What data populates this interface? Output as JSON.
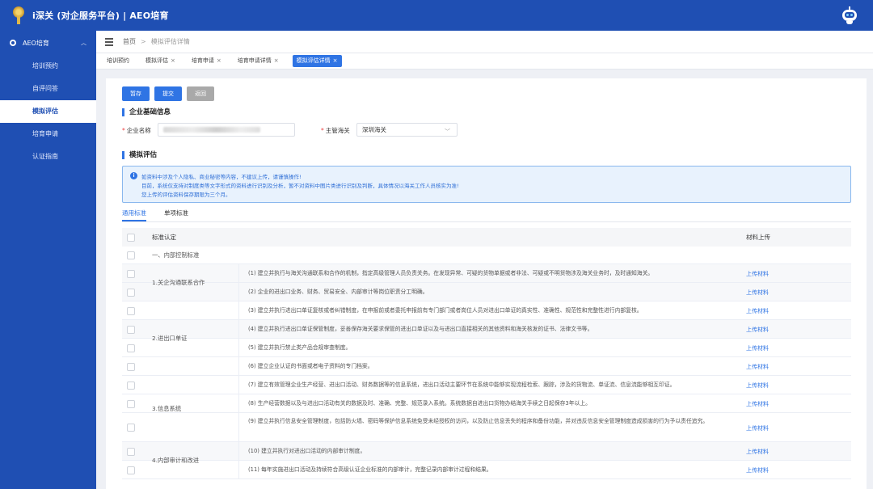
{
  "header": {
    "title": "i深关 (对企服务平台) | AEO培育"
  },
  "sidebar": {
    "group_label": "AEO培育",
    "items": [
      {
        "label": "培训预约",
        "active": false
      },
      {
        "label": "自评问答",
        "active": false
      },
      {
        "label": "模拟评估",
        "active": true
      },
      {
        "label": "培育申请",
        "active": false
      },
      {
        "label": "认证指南",
        "active": false
      }
    ]
  },
  "breadcrumb": {
    "home": "首页",
    "current": "模拟评估详情"
  },
  "tabs": [
    {
      "label": "培训预约",
      "closable": false,
      "active": false
    },
    {
      "label": "模拟评估",
      "closable": true,
      "active": false
    },
    {
      "label": "培育申请",
      "closable": true,
      "active": false
    },
    {
      "label": "培育申请详情",
      "closable": true,
      "active": false
    },
    {
      "label": "模拟评估详情",
      "closable": true,
      "active": true
    }
  ],
  "toolbar": {
    "save_label": "暂存",
    "submit_label": "提交",
    "back_label": "返回"
  },
  "basic_info": {
    "section_title": "企业基础信息",
    "company_label": "企业名称",
    "customs_label": "主管海关",
    "customs_value": "深圳海关"
  },
  "evaluation": {
    "section_title": "模拟评估",
    "notice_lines": [
      "如资料中涉及个人隐私、商业秘密等内容，不建议上传，请谨慎操作!",
      "目前，系统仅支持对制度类等文字形式的资料进行识别及分析，暂不对资料中图片类进行识别及判断，具体情况以海关工作人员核实为准!",
      "您上传的评估资料保存期限为三个月。"
    ],
    "subtabs": [
      "通用标准",
      "单项标准"
    ]
  },
  "table": {
    "col_standard": "标准认定",
    "col_upload": "材料上传",
    "section_row": "一、内部控制标准",
    "upload_label": "上传材料",
    "groups": [
      {
        "name": "1.关企沟通联系合作",
        "items": [
          "(1) 建立并执行与海关沟通联系和合作的机制，指定高级管理人员负责关务。在发现异常、可疑的货物单据或者非法、可疑或不明货物涉及海关业务时，及时通知海关。",
          "(2) 企业的进出口业务、财务、贸易安全、内部审计等岗位职责分工明确。"
        ]
      },
      {
        "name": "2.进出口单证",
        "items": [
          "(3) 建立并执行进出口单证复核或者纠错制度，在申报前或者委托申报前有专门部门或者岗位人员对进出口单证的真实性、准确性、规范性和完整性进行内部复核。",
          "(4) 建立并执行进出口单证保管制度，妥善保存海关要求保管的进出口单证以及与进出口直接相关的其他资料和海关核发的证书、法律文书等。",
          "(5) 建立并执行禁止类产品合规审查制度。",
          "(6) 建立企业认证的书面或者电子资料的专门档案。"
        ]
      },
      {
        "name": "3.信息系统",
        "items": [
          "(7) 建立有效管理企业生产经营、进出口活动、财务数据等的信息系统，进出口活动主要环节在系统中能够实现流程检索、跟踪，涉及的货物流、单证流、信息流能够相互印证。",
          "(8) 生产经营数据以及与进出口活动有关的数据及时、准确、完整、规范录入系统。系统数据自进出口货物办结海关手续之日起保存3年以上。",
          "(9) 建立并执行信息安全管理制度，包括防火墙、密码等保护信息系统免受未经授权的访问，以及防止信息丢失的程序和备份功能，并对违反信息安全管理制度造成损害的行为予以责任追究。"
        ]
      },
      {
        "name": "4.内部审计和改进",
        "items": [
          "(10) 建立并执行对进出口活动的内部审计制度。",
          "(11) 每年实施进出口活动及持续符合高级认证企业标准的内部审计，完整记录内部审计过程和结果。"
        ]
      }
    ]
  }
}
